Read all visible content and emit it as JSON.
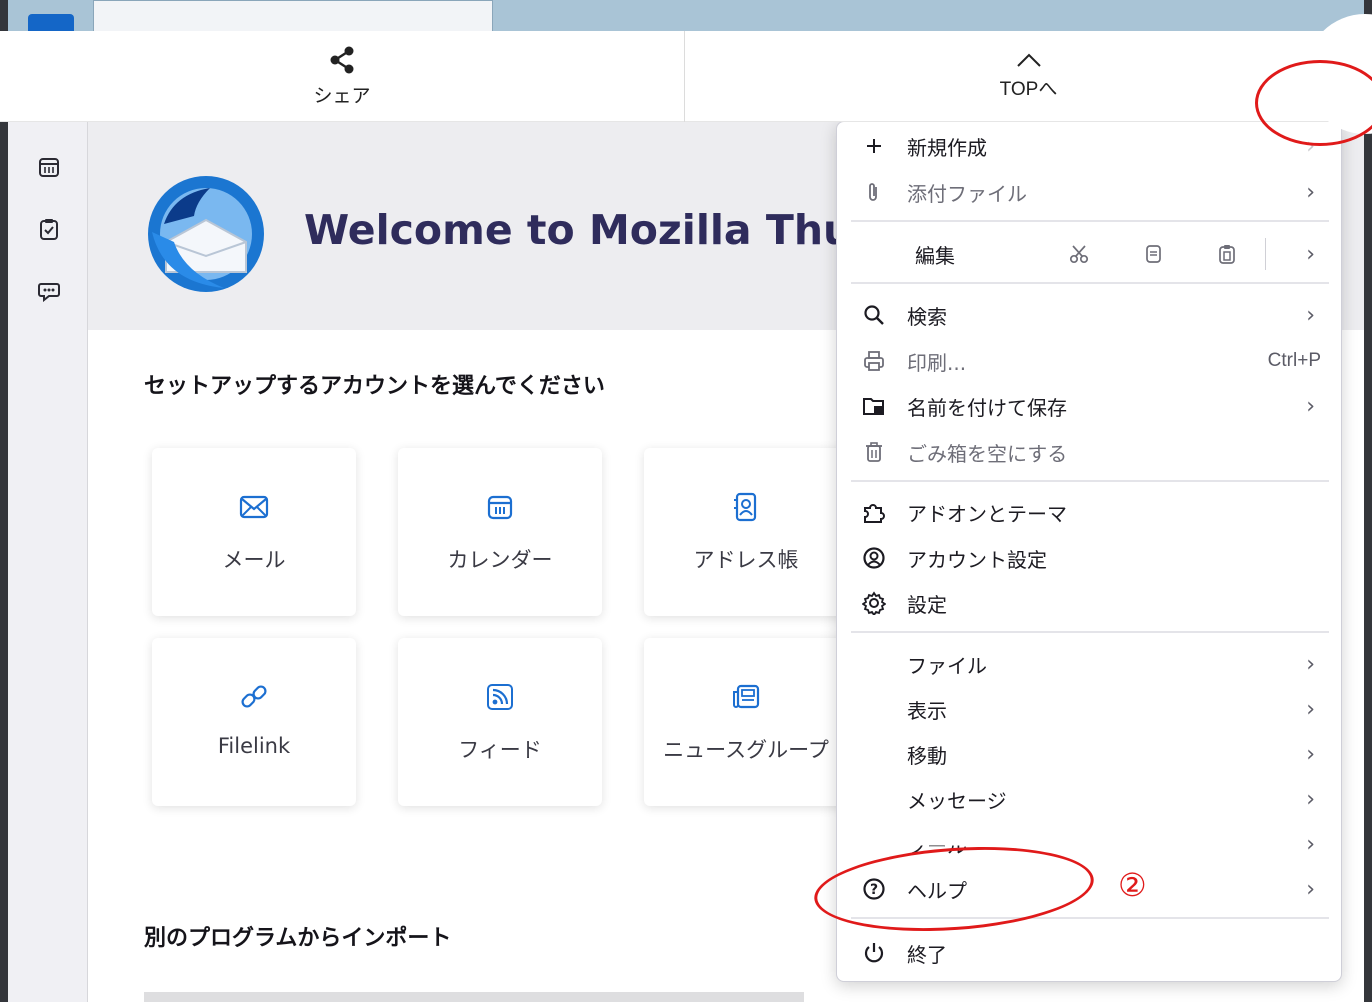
{
  "banner": {
    "share_label": "シェア",
    "top_label": "TOPへ"
  },
  "welcome": {
    "title": "Welcome to Mozilla Thunderbird",
    "setup_heading": "セットアップするアカウントを選んでください",
    "import_heading": "別のプログラムからインポート",
    "cards": [
      {
        "label": "メール",
        "icon": "mail-icon"
      },
      {
        "label": "カレンダー",
        "icon": "calendar-icon"
      },
      {
        "label": "アドレス帳",
        "icon": "address-book-icon"
      },
      {
        "label": "Filelink",
        "icon": "link-icon"
      },
      {
        "label": "フィード",
        "icon": "rss-feed-icon"
      },
      {
        "label": "ニュースグループ",
        "icon": "newsgroup-icon"
      }
    ]
  },
  "spaces": [
    "calendar-icon",
    "tasks-icon",
    "chat-icon"
  ],
  "menu": {
    "new": "新規作成",
    "attach": "添付ファイル",
    "edit": "編集",
    "search": "検索",
    "print": "印刷...",
    "print_shortcut": "Ctrl+P",
    "save_as": "名前を付けて保存",
    "empty_trash": "ごみ箱を空にする",
    "addons": "アドオンとテーマ",
    "account_settings": "アカウント設定",
    "settings": "設定",
    "file": "ファイル",
    "view": "表示",
    "go": "移動",
    "message": "メッセージ",
    "tools": "ツール",
    "help": "ヘルプ",
    "quit": "終了"
  },
  "annotation": {
    "number": "②",
    "color": "#e01a1a"
  }
}
